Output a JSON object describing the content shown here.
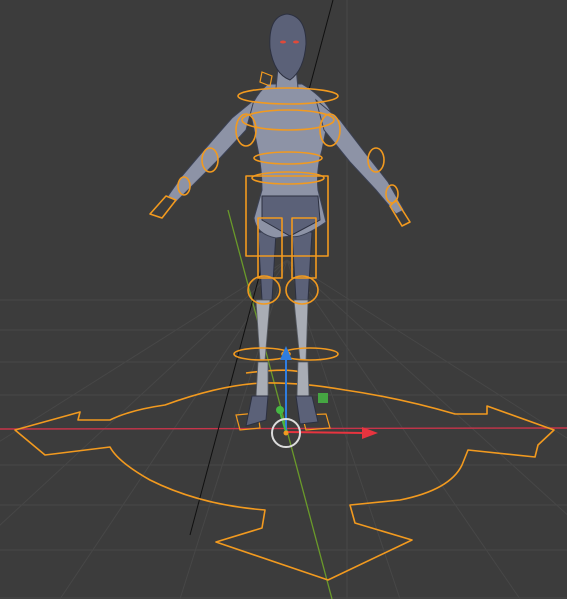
{
  "viewport": {
    "name": "3D Viewport",
    "colors": {
      "background": "#3c3c3c",
      "grid": "#474747",
      "x_axis": "#c8344a",
      "y_axis": "#6a9a2a",
      "rig_selected": "#f29a1f",
      "gizmo_x": "#e8343f",
      "gizmo_z": "#2f7de0",
      "gizmo_y": "#46b843"
    },
    "objects": {
      "character_mesh": "humanoid-mesh",
      "armature": "armature-rig",
      "root_control": "root-arrow-control",
      "light_line": "light-direction-line",
      "cursor": "3d-cursor"
    },
    "transform_gizmo": {
      "type": "move-gizmo",
      "axes": [
        "x-arrow-icon",
        "y-handle-icon",
        "z-arrow-icon"
      ]
    }
  }
}
